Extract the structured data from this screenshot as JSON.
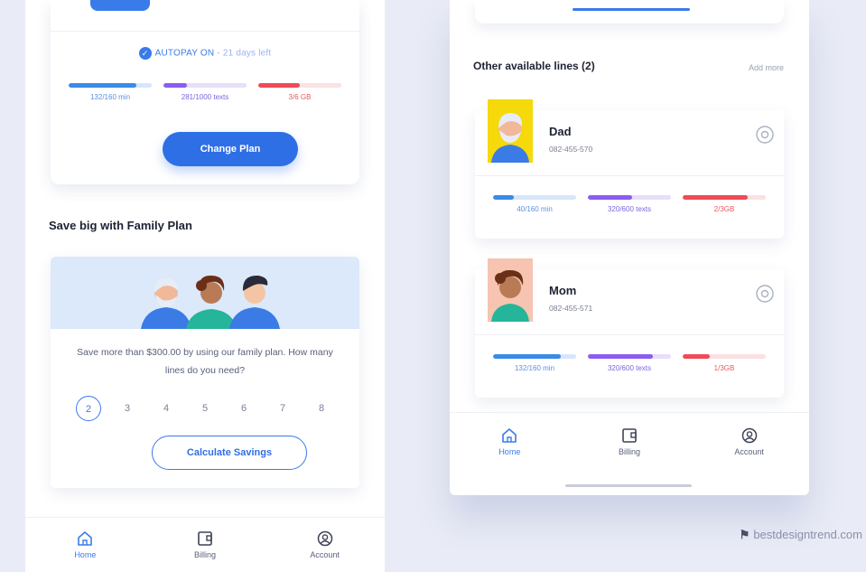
{
  "left_screen": {
    "plan_card": {
      "autopay_label": "AUTOPAY ON",
      "autopay_days": "- 21 days left",
      "usage": [
        {
          "label": "132/160 min",
          "fill": 0.82,
          "kind": "blue"
        },
        {
          "label": "281/1000 texts",
          "fill": 0.28,
          "kind": "purple"
        },
        {
          "label": "3/6 GB",
          "fill": 0.5,
          "kind": "red"
        }
      ],
      "change_plan_label": "Change Plan"
    },
    "family_section_title": "Save big with Family Plan",
    "family_card": {
      "description": "Save more than $300.00 by using our family plan. How many lines do you need?",
      "line_options": [
        "2",
        "3",
        "4",
        "5",
        "6",
        "7",
        "8"
      ],
      "selected_option": "2",
      "calculate_label": "Calculate Savings"
    },
    "tabs": [
      {
        "label": "Home",
        "icon": "home-icon",
        "active": true
      },
      {
        "label": "Billing",
        "icon": "billing-icon",
        "active": false
      },
      {
        "label": "Account",
        "icon": "account-icon",
        "active": false
      }
    ]
  },
  "right_screen": {
    "heading": "Other available lines (2)",
    "add_more": "Add more",
    "lines": [
      {
        "name": "Dad",
        "number": "082-455-570",
        "avatar_bg": "#f5d90a",
        "usage": [
          {
            "label": "40/160 min",
            "fill": 0.25,
            "kind": "blue"
          },
          {
            "label": "320/600 texts",
            "fill": 0.53,
            "kind": "purple"
          },
          {
            "label": "2/3GB",
            "fill": 0.78,
            "kind": "red"
          }
        ]
      },
      {
        "name": "Mom",
        "number": "082-455-571",
        "avatar_bg": "#f6c4b0",
        "usage": [
          {
            "label": "132/160 min",
            "fill": 0.82,
            "kind": "blue"
          },
          {
            "label": "320/600 texts",
            "fill": 0.78,
            "kind": "purple"
          },
          {
            "label": "1/3GB",
            "fill": 0.33,
            "kind": "red"
          }
        ]
      }
    ],
    "tabs": [
      {
        "label": "Home",
        "icon": "home-icon",
        "active": true
      },
      {
        "label": "Billing",
        "icon": "billing-icon",
        "active": false
      },
      {
        "label": "Account",
        "icon": "account-icon",
        "active": false
      }
    ]
  },
  "watermark": "bestdesigntrend.com",
  "colors": {
    "accent": "#2f6fe6",
    "minutes": "#3a8be8",
    "texts": "#8b5cf0",
    "data": "#ef4b57"
  }
}
